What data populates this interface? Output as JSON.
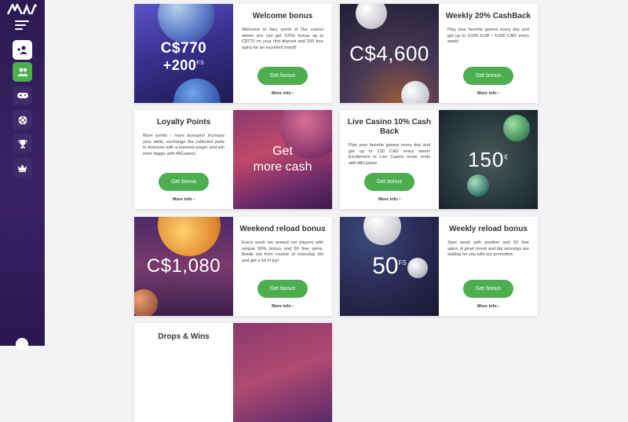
{
  "sidebar": {
    "logo": "All",
    "icons": [
      "menu-icon",
      "user-icon",
      "users-icon",
      "gamepad-icon",
      "chip-icon",
      "trophy-icon",
      "crown-icon",
      "chat-icon"
    ]
  },
  "cards": [
    {
      "title": "Welcome bonus",
      "text": "Welcome to fairy world of Our casino where you can get 100% bonus up to C$770 on your first deposit and 200 free spins for an excellent mood!",
      "button": "Get bonus",
      "more": "More info",
      "img_line1": "C$770",
      "img_line2": "+200",
      "img_sup": "FS"
    },
    {
      "title": "Weekly 20% CashBack",
      "text": "Play your favorite games every day and get up to 3,000 EUR / 4,600 CAD every week!",
      "button": "Get bonus",
      "more": "More info",
      "img_line1": "C$4,600"
    },
    {
      "title": "Loyalty Points",
      "text": "More points - more bonuses! Increase your skills, exchange the collected poits to bonuses with a lowered wager and win even bigger with AllCasino!",
      "button": "Get bonus",
      "more": "More info",
      "img_line1": "Get",
      "img_line2": "more cash"
    },
    {
      "title": "Live Casino 10% Cash Back",
      "text": "Play your favorite games every day and get up to 230 CAD every week! Excitement in Live Casino never ends with AllCasino!",
      "button": "Get bonus",
      "more": "More info",
      "img_line1": "150",
      "img_sup": "€"
    },
    {
      "title": "Weekend reload bonus",
      "text": "Every week we reward our players with unique 50% bonus and 50 free spins. Break out from routine of everyday life and get a lot of joy!",
      "button": "Get bonus",
      "more": "More info",
      "img_line1": "C$1,080"
    },
    {
      "title": "Weekly reload bonus",
      "text": "Start week with positive and 50 free spins. A good mood and big winnings are waiting for you with our promotion.",
      "button": "Get bonus",
      "more": "More info",
      "img_line1": "50",
      "img_sup": "FS"
    },
    {
      "title": "Drops & Wins"
    }
  ]
}
